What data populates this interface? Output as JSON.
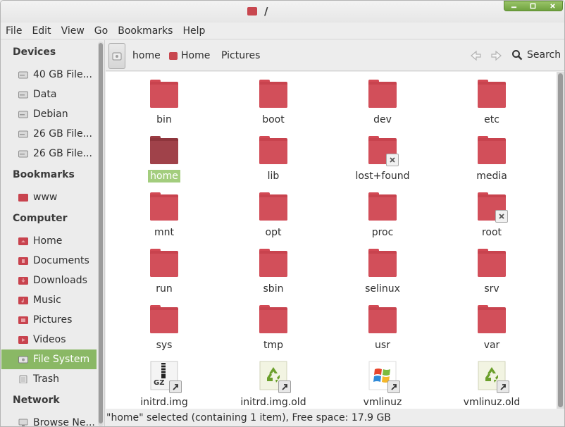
{
  "window": {
    "title": "/",
    "buttons": [
      "minimize",
      "maximize",
      "close"
    ]
  },
  "menu": [
    "File",
    "Edit",
    "View",
    "Go",
    "Bookmarks",
    "Help"
  ],
  "sidebar": {
    "devices_heading": "Devices",
    "devices": [
      {
        "label": "40 GB File...",
        "icon": "drive-icon"
      },
      {
        "label": "Data",
        "icon": "drive-icon"
      },
      {
        "label": "Debian",
        "icon": "drive-icon"
      },
      {
        "label": "26 GB File...",
        "icon": "drive-icon"
      },
      {
        "label": "26 GB File...",
        "icon": "drive-icon"
      }
    ],
    "bookmarks_heading": "Bookmarks",
    "bookmarks": [
      {
        "label": "www",
        "icon": "folder-icon"
      }
    ],
    "computer_heading": "Computer",
    "computer": [
      {
        "label": "Home",
        "icon": "home-icon"
      },
      {
        "label": "Documents",
        "icon": "documents-icon"
      },
      {
        "label": "Downloads",
        "icon": "downloads-icon"
      },
      {
        "label": "Music",
        "icon": "music-icon"
      },
      {
        "label": "Pictures",
        "icon": "pictures-icon"
      },
      {
        "label": "Videos",
        "icon": "videos-icon"
      },
      {
        "label": "File System",
        "icon": "drive-icon",
        "selected": true
      },
      {
        "label": "Trash",
        "icon": "trash-icon"
      }
    ],
    "network_heading": "Network",
    "network": [
      {
        "label": "Browse Ne...",
        "icon": "network-icon"
      }
    ]
  },
  "toolbar": {
    "crumbs": [
      "home",
      "Home",
      "Pictures"
    ],
    "search_label": "Search"
  },
  "files": [
    {
      "name": "bin",
      "type": "folder"
    },
    {
      "name": "boot",
      "type": "folder"
    },
    {
      "name": "dev",
      "type": "folder"
    },
    {
      "name": "etc",
      "type": "folder"
    },
    {
      "name": "home",
      "type": "folder",
      "selected": true
    },
    {
      "name": "lib",
      "type": "folder"
    },
    {
      "name": "lost+found",
      "type": "folder",
      "badge": "no-access"
    },
    {
      "name": "media",
      "type": "folder"
    },
    {
      "name": "mnt",
      "type": "folder"
    },
    {
      "name": "opt",
      "type": "folder"
    },
    {
      "name": "proc",
      "type": "folder"
    },
    {
      "name": "root",
      "type": "folder",
      "badge": "no-access"
    },
    {
      "name": "run",
      "type": "folder"
    },
    {
      "name": "sbin",
      "type": "folder"
    },
    {
      "name": "selinux",
      "type": "folder"
    },
    {
      "name": "srv",
      "type": "folder"
    },
    {
      "name": "sys",
      "type": "folder"
    },
    {
      "name": "tmp",
      "type": "folder"
    },
    {
      "name": "usr",
      "type": "folder"
    },
    {
      "name": "var",
      "type": "folder"
    },
    {
      "name": "initrd.img",
      "type": "archive-link"
    },
    {
      "name": "initrd.img.old",
      "type": "recycle-link"
    },
    {
      "name": "vmlinuz",
      "type": "windows-link"
    },
    {
      "name": "vmlinuz.old",
      "type": "recycle-link"
    }
  ],
  "status": "\"home\" selected (containing 1 item), Free space: 17.9 GB",
  "colors": {
    "folder": "#c8434e",
    "selection": "#8ab865",
    "selection_label": "#a3cd7e"
  }
}
